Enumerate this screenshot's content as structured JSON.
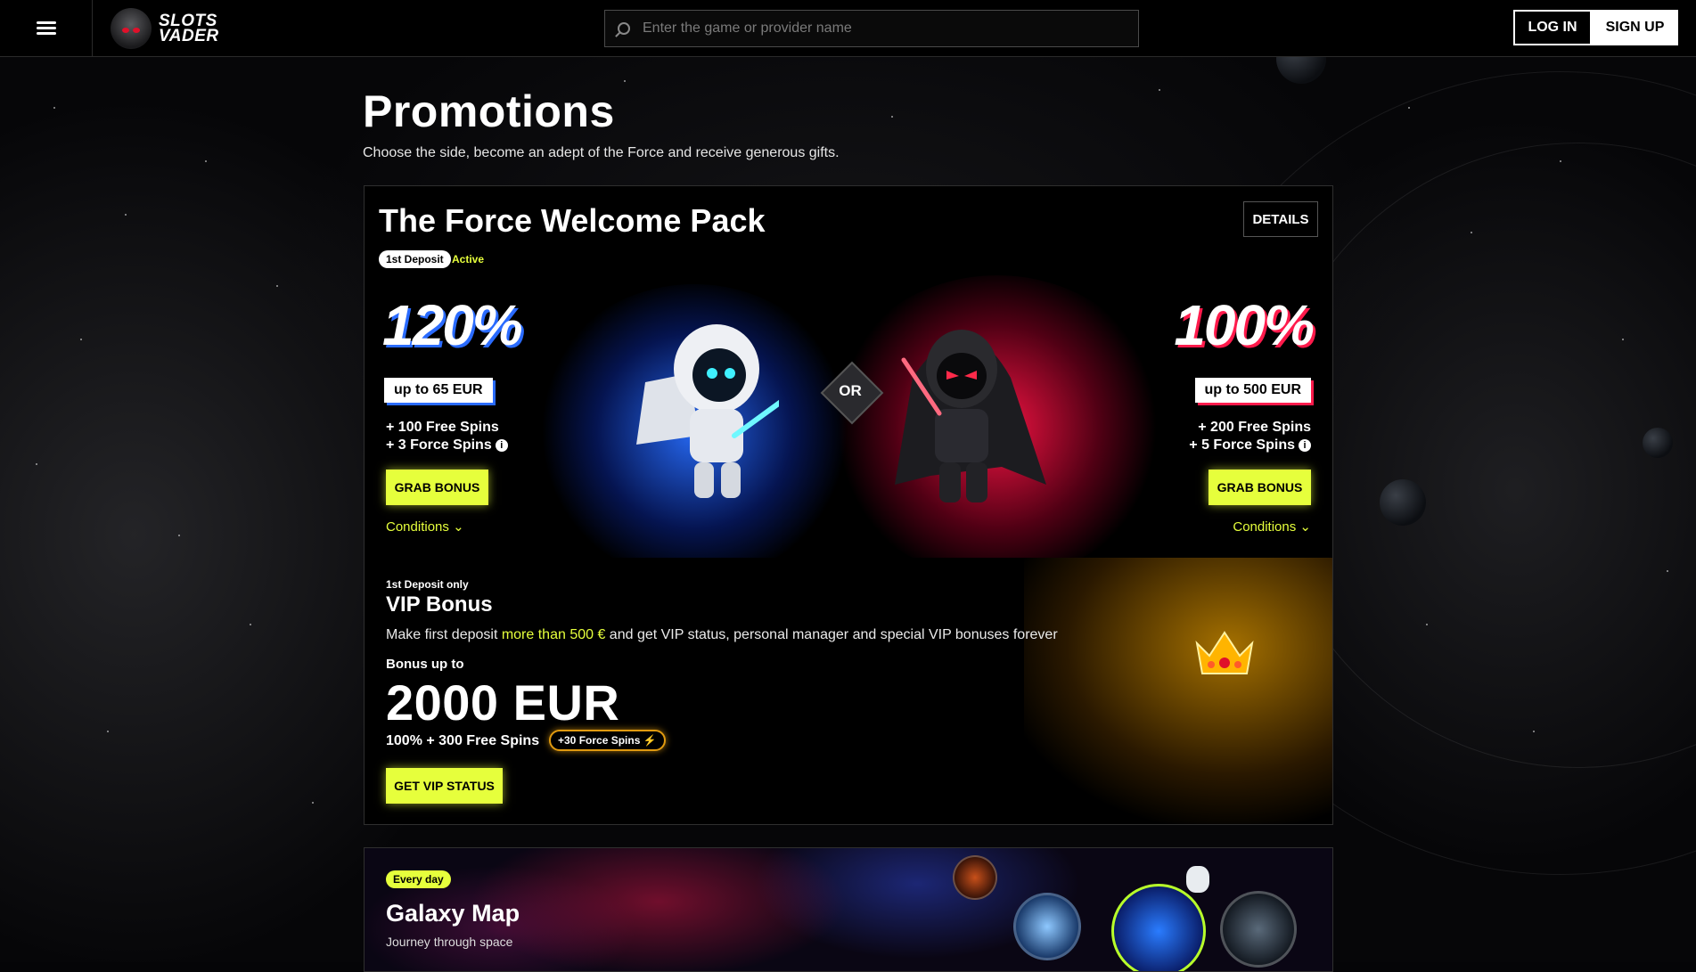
{
  "header": {
    "logo_line1": "SLOTS",
    "logo_line2": "VADER",
    "search_placeholder": "Enter the game or provider name",
    "login_label": "LOG IN",
    "signup_label": "SIGN UP"
  },
  "page": {
    "title": "Promotions",
    "subtitle": "Choose the side, become an adept of the Force and receive generous gifts."
  },
  "force_pack": {
    "title": "The Force Welcome Pack",
    "details_label": "DETAILS",
    "tag": "1st Deposit",
    "status": "Active",
    "or_label": "OR",
    "left_offer": {
      "percent": "120%",
      "upto": "up to 65 EUR",
      "free_spins": "+ 100 Free Spins",
      "force_spins": "+ 3 Force Spins",
      "button": "GRAB BONUS",
      "conditions": "Conditions"
    },
    "right_offer": {
      "percent": "100%",
      "upto": "up to 500 EUR",
      "free_spins": "+ 200 Free Spins",
      "force_spins": "+ 5 Force Spins",
      "button": "GRAB BONUS",
      "conditions": "Conditions"
    },
    "colors": {
      "accent": "#e6ff3c",
      "light_side": "#2a6bff",
      "dark_side": "#ff1a4b"
    }
  },
  "vip": {
    "small_label": "1st Deposit only",
    "title": "VIP Bonus",
    "desc_before": "Make first deposit ",
    "desc_highlight": "more than 500 €",
    "desc_after": " and get VIP status, personal manager and special VIP bonuses forever",
    "bonus_upto": "Bonus up to",
    "amount": "2000 EUR",
    "spins": "100% + 300 Free Spins",
    "force_badge": "+30 Force Spins ⚡",
    "button": "GET VIP STATUS"
  },
  "galaxy": {
    "tag": "Every day",
    "title": "Galaxy Map",
    "subtitle": "Journey through space"
  },
  "icons": {
    "menu": "hamburger-icon",
    "search": "search-icon",
    "info": "info-icon",
    "chevron": "chevron-down-icon",
    "crown": "crown-icon"
  }
}
